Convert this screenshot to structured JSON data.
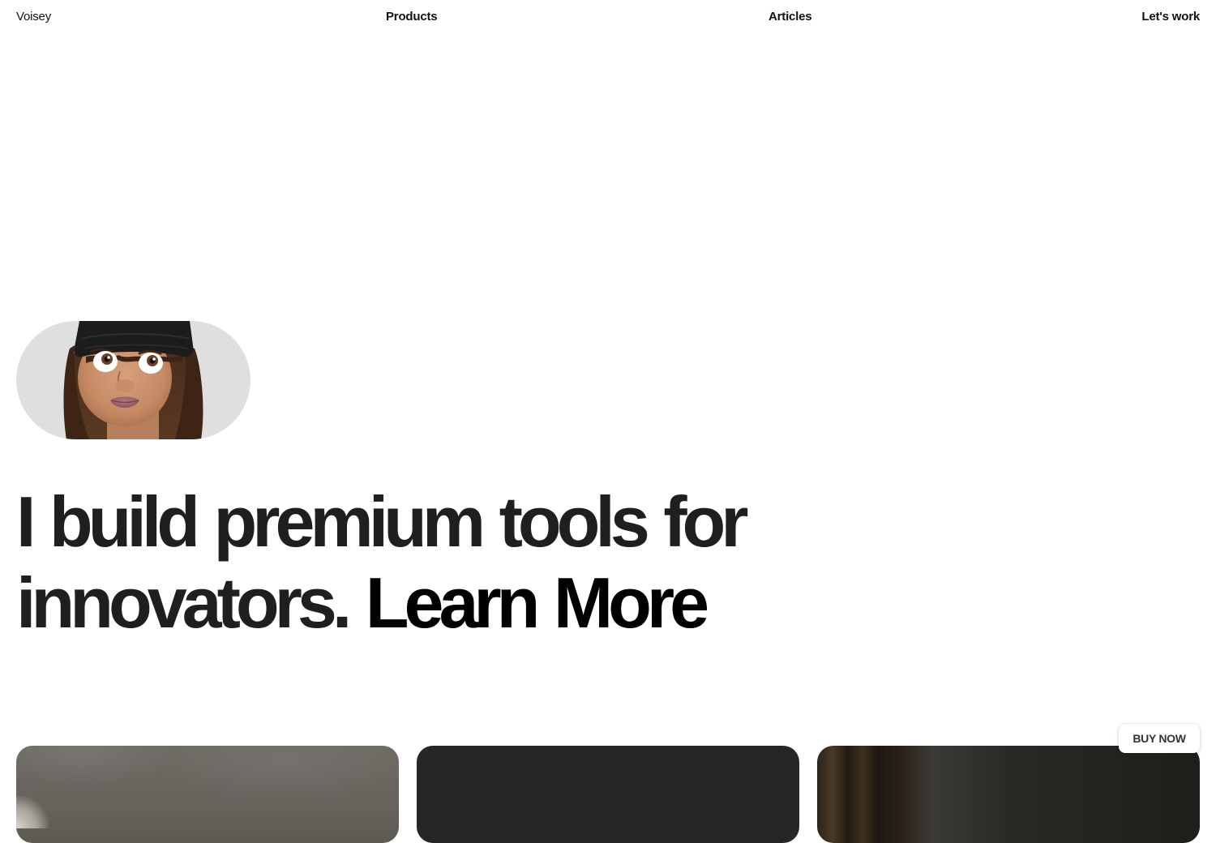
{
  "nav": {
    "brand": "Voisey",
    "products": "Products",
    "articles": "Articles",
    "contact": "Let's work"
  },
  "hero": {
    "avatar_icon": "memoji-avatar-icon",
    "headline_text": "I build premium tools for innovators.",
    "headline_link": "Learn More"
  },
  "cards": [
    {
      "name": "product-card-1",
      "color": "#66635d"
    },
    {
      "name": "product-card-2",
      "color": "#262626"
    },
    {
      "name": "product-card-3",
      "color": "#2a2925"
    }
  ],
  "buy_now": {
    "label": "BUY NOW"
  },
  "colors": {
    "background": "#ffffff",
    "text": "#1f1f1f",
    "avatar_pill": "#dfdfdf"
  }
}
